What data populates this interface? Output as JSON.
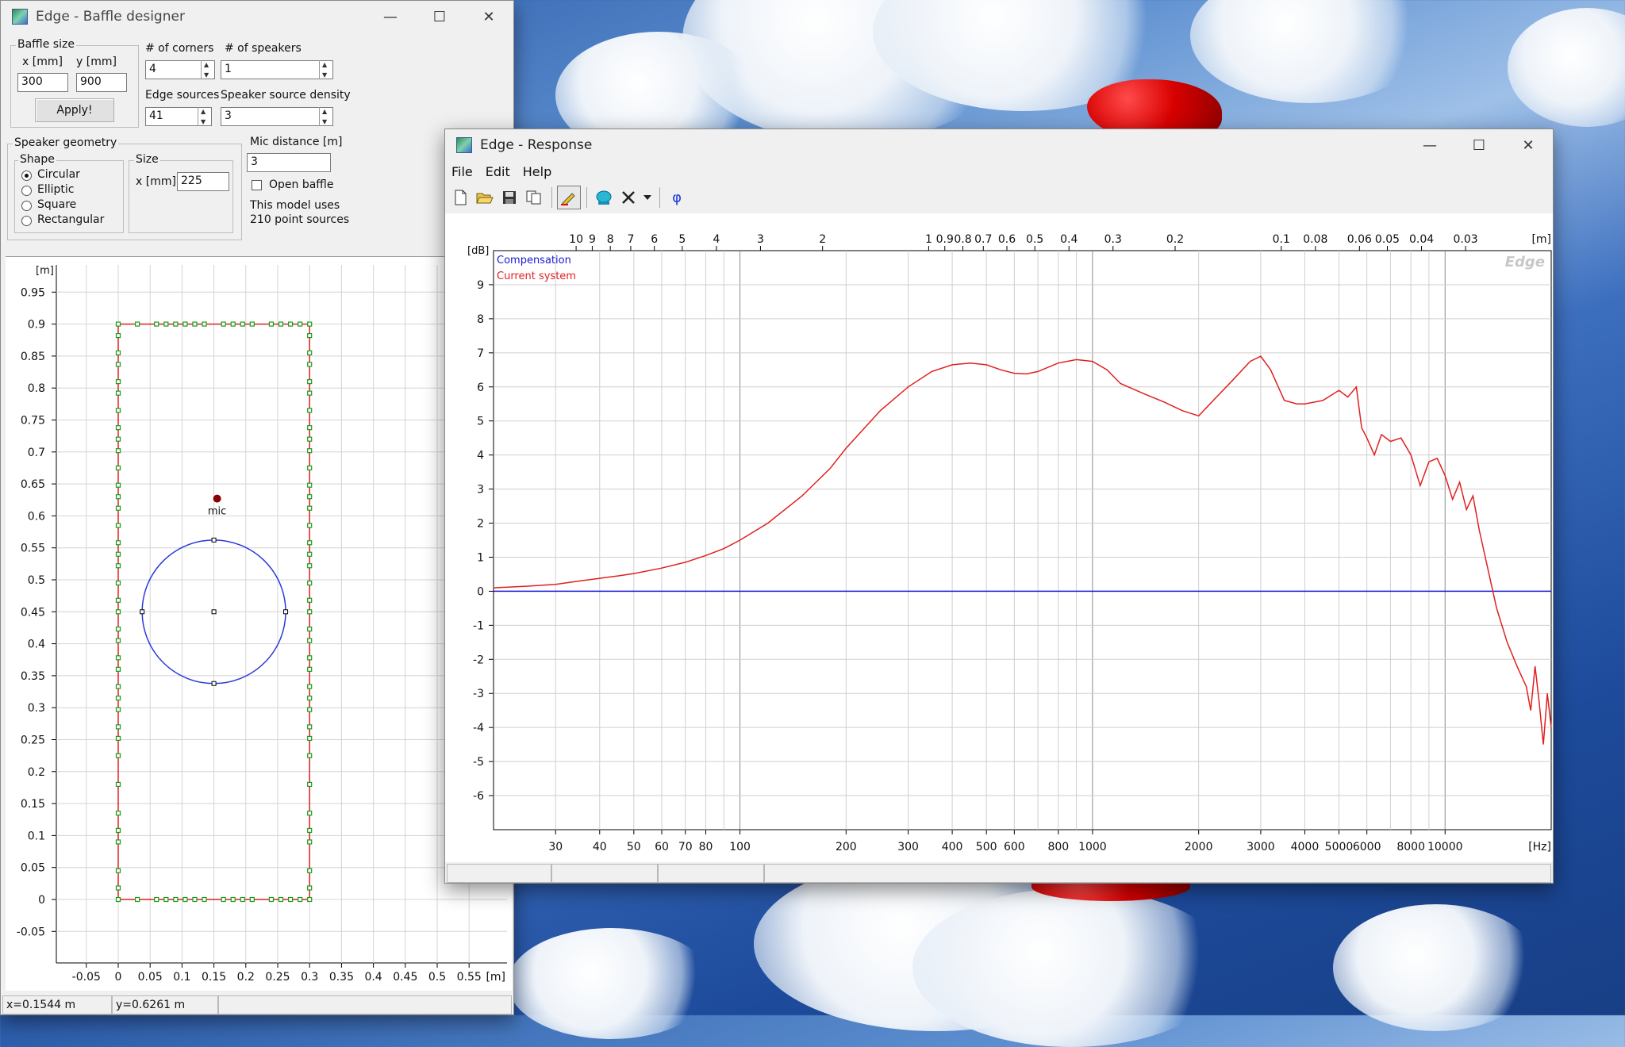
{
  "baffle_window": {
    "title": "Edge - Baffle designer",
    "baffle_size": {
      "group_label": "Baffle size",
      "x_label": "x [mm]",
      "x_value": "300",
      "y_label": "y [mm]",
      "y_value": "900",
      "apply_label": "Apply!"
    },
    "corners": {
      "label": "# of corners",
      "value": "4"
    },
    "speakers": {
      "label": "# of speakers",
      "value": "1"
    },
    "edge_sources": {
      "label": "Edge sources",
      "value": "41"
    },
    "speaker_density": {
      "label": "Speaker source density",
      "value": "3"
    },
    "speaker_geometry": {
      "group_label": "Speaker geometry",
      "shape_label": "Shape",
      "shapes": [
        "Circular",
        "Elliptic",
        "Square",
        "Rectangular"
      ],
      "selected_shape": "Circular",
      "size_label": "Size",
      "size_x_label": "x [mm]",
      "size_x_value": "225"
    },
    "mic_distance": {
      "label": "Mic distance [m]",
      "value": "3"
    },
    "open_baffle": {
      "label": "Open baffle",
      "checked": false
    },
    "model_info": [
      "This model uses",
      "210 point sources"
    ],
    "plot": {
      "y_unit": "[m]",
      "x_unit": "[m]",
      "y_ticks": [
        "0.95",
        "0.9",
        "0.85",
        "0.8",
        "0.75",
        "0.7",
        "0.65",
        "0.6",
        "0.55",
        "0.5",
        "0.45",
        "0.4",
        "0.35",
        "0.3",
        "0.25",
        "0.2",
        "0.15",
        "0.1",
        "0.05",
        "0",
        "-0.05"
      ],
      "x_ticks": [
        "-0.05",
        "0",
        "0.05",
        "0.1",
        "0.15",
        "0.2",
        "0.25",
        "0.3",
        "0.35",
        "0.4",
        "0.45",
        "0.5",
        "0.55"
      ],
      "mic_label": "mic",
      "baffle_width_m": 0.3,
      "baffle_height_m": 0.9,
      "speaker_center": [
        0.15,
        0.45
      ],
      "speaker_radius_m": 0.1125,
      "mic_position": [
        0.155,
        0.627
      ],
      "colors": {
        "baffle": "#e02020",
        "sources": "#1a9a1a",
        "speaker": "#2a3ad8",
        "mic": "#8b0000"
      }
    },
    "status": {
      "x": "x=0.1544 m",
      "y": "y=0.6261 m"
    }
  },
  "response_window": {
    "title": "Edge - Response",
    "menu": [
      "File",
      "Edit",
      "Help"
    ],
    "toolbar_icons": [
      "new-file-icon",
      "open-folder-icon",
      "save-icon",
      "copy-icon",
      "draw-pencil-icon",
      "speaker-icon",
      "delete-x-icon",
      "dropdown-arrow-icon",
      "phase-phi-icon"
    ],
    "phase_symbol": "φ"
  },
  "chart_data": {
    "type": "line",
    "xscale": "log",
    "xlim": [
      20,
      20000
    ],
    "ylim": [
      -7,
      10
    ],
    "y_unit": "[dB]",
    "x_unit": "[Hz]",
    "top_unit": "[m]",
    "watermark": "Edge",
    "x_tick_labels": [
      "30",
      "40",
      "50",
      "60",
      "70",
      "80",
      "100",
      "200",
      "300",
      "400",
      "500",
      "600",
      "800",
      "1000",
      "2000",
      "3000",
      "4000",
      "5000",
      "6000",
      "8000",
      "10000"
    ],
    "y_tick_labels": [
      "9",
      "8",
      "7",
      "6",
      "5",
      "4",
      "3",
      "2",
      "1",
      "0",
      "-1",
      "-2",
      "-3",
      "-4",
      "-5",
      "-6"
    ],
    "top_tick_labels": [
      "10",
      "9",
      "8",
      "7",
      "6",
      "5",
      "4",
      "3",
      "2",
      "1",
      "0.9",
      "0.8",
      "0.7",
      "0.6",
      "0.5",
      "0.4",
      "0.3",
      "0.2",
      "0.1",
      "0.08",
      "0.06",
      "0.05",
      "0.04",
      "0.03"
    ],
    "series": [
      {
        "name": "Compensation",
        "color": "#1a1ad6",
        "x": [
          20,
          20000
        ],
        "y": [
          0,
          0
        ]
      },
      {
        "name": "Current system",
        "color": "#e02020",
        "x": [
          20,
          25,
          30,
          35,
          40,
          45,
          50,
          60,
          70,
          80,
          90,
          100,
          120,
          150,
          180,
          200,
          250,
          300,
          350,
          400,
          450,
          500,
          550,
          600,
          650,
          700,
          800,
          900,
          1000,
          1100,
          1200,
          1400,
          1600,
          1800,
          2000,
          2200,
          2500,
          2800,
          3000,
          3200,
          3500,
          3800,
          4000,
          4500,
          5000,
          5300,
          5600,
          5800,
          6000,
          6300,
          6600,
          7000,
          7500,
          8000,
          8500,
          9000,
          9500,
          10000,
          10500,
          11000,
          11500,
          12000,
          12500,
          13000,
          14000,
          15000,
          16000,
          17000,
          17500,
          18000,
          18500,
          19000,
          19500,
          20000
        ],
        "y": [
          0.1,
          0.15,
          0.2,
          0.3,
          0.38,
          0.45,
          0.52,
          0.68,
          0.85,
          1.05,
          1.25,
          1.5,
          2.0,
          2.8,
          3.6,
          4.2,
          5.3,
          6.0,
          6.45,
          6.65,
          6.7,
          6.65,
          6.5,
          6.4,
          6.38,
          6.45,
          6.7,
          6.8,
          6.75,
          6.5,
          6.1,
          5.8,
          5.55,
          5.3,
          5.15,
          5.6,
          6.2,
          6.75,
          6.9,
          6.5,
          5.6,
          5.5,
          5.5,
          5.6,
          5.9,
          5.7,
          6.0,
          4.8,
          4.5,
          4.0,
          4.6,
          4.4,
          4.5,
          4.0,
          3.1,
          3.8,
          3.9,
          3.4,
          2.7,
          3.2,
          2.4,
          2.8,
          1.8,
          1.0,
          -0.5,
          -1.5,
          -2.2,
          -2.8,
          -3.5,
          -2.2,
          -3.3,
          -4.5,
          -3.0,
          -4.0
        ]
      }
    ]
  }
}
